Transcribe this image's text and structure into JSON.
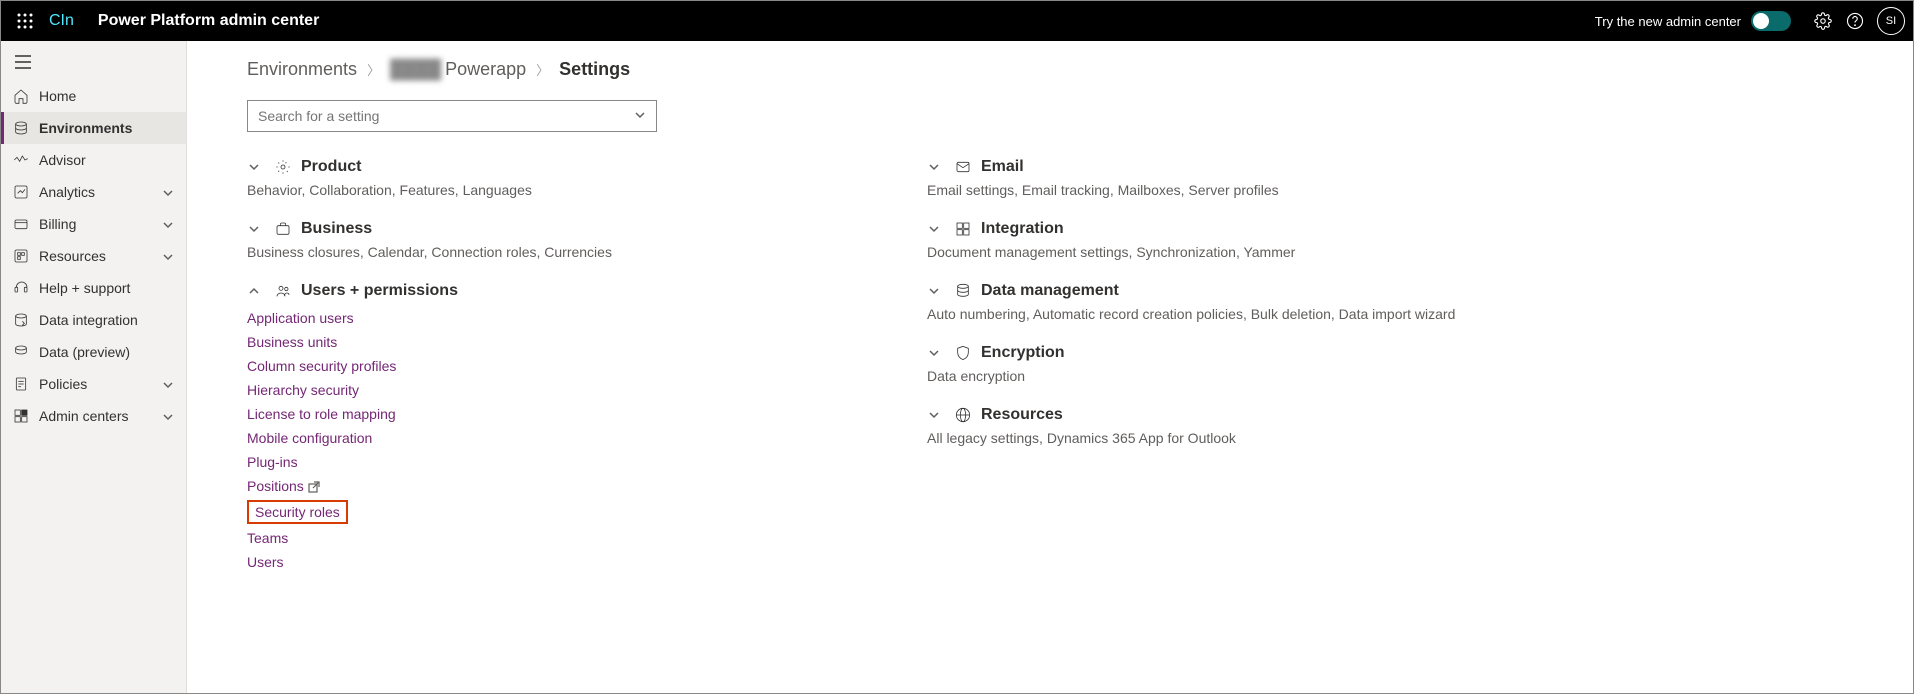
{
  "header": {
    "brand": "CIn",
    "title": "Power Platform admin center",
    "try_label": "Try the new admin center",
    "avatar": "SI"
  },
  "sidebar": {
    "items": [
      {
        "label": "Home",
        "icon": "home",
        "expandable": false,
        "active": false
      },
      {
        "label": "Environments",
        "icon": "environments",
        "expandable": false,
        "active": true
      },
      {
        "label": "Advisor",
        "icon": "advisor",
        "expandable": false,
        "active": false
      },
      {
        "label": "Analytics",
        "icon": "analytics",
        "expandable": true,
        "active": false
      },
      {
        "label": "Billing",
        "icon": "billing",
        "expandable": true,
        "active": false
      },
      {
        "label": "Resources",
        "icon": "resources",
        "expandable": true,
        "active": false
      },
      {
        "label": "Help + support",
        "icon": "help",
        "expandable": false,
        "active": false
      },
      {
        "label": "Data integration",
        "icon": "dataint",
        "expandable": false,
        "active": false
      },
      {
        "label": "Data (preview)",
        "icon": "data",
        "expandable": false,
        "active": false
      },
      {
        "label": "Policies",
        "icon": "policies",
        "expandable": true,
        "active": false
      },
      {
        "label": "Admin centers",
        "icon": "admin",
        "expandable": true,
        "active": false
      }
    ]
  },
  "breadcrumb": {
    "root": "Environments",
    "env": "Powerapp",
    "current": "Settings"
  },
  "search": {
    "placeholder": "Search for a setting"
  },
  "groups_left": [
    {
      "title": "Product",
      "icon": "gear",
      "expanded": false,
      "sub": "Behavior, Collaboration, Features, Languages",
      "links": []
    },
    {
      "title": "Business",
      "icon": "briefcase",
      "expanded": false,
      "sub": "Business closures, Calendar, Connection roles, Currencies",
      "links": []
    },
    {
      "title": "Users + permissions",
      "icon": "people",
      "expanded": true,
      "sub": "",
      "links": [
        {
          "label": "Application users",
          "highlight": false,
          "external": false
        },
        {
          "label": "Business units",
          "highlight": false,
          "external": false
        },
        {
          "label": "Column security profiles",
          "highlight": false,
          "external": false
        },
        {
          "label": "Hierarchy security",
          "highlight": false,
          "external": false
        },
        {
          "label": "License to role mapping",
          "highlight": false,
          "external": false
        },
        {
          "label": "Mobile configuration",
          "highlight": false,
          "external": false
        },
        {
          "label": "Plug-ins",
          "highlight": false,
          "external": false
        },
        {
          "label": "Positions",
          "highlight": false,
          "external": true
        },
        {
          "label": "Security roles",
          "highlight": true,
          "external": false
        },
        {
          "label": "Teams",
          "highlight": false,
          "external": false
        },
        {
          "label": "Users",
          "highlight": false,
          "external": false
        }
      ]
    }
  ],
  "groups_right": [
    {
      "title": "Email",
      "icon": "mail",
      "expanded": false,
      "sub": "Email settings, Email tracking, Mailboxes, Server profiles"
    },
    {
      "title": "Integration",
      "icon": "grid",
      "expanded": false,
      "sub": "Document management settings, Synchronization, Yammer"
    },
    {
      "title": "Data management",
      "icon": "database",
      "expanded": false,
      "sub": "Auto numbering, Automatic record creation policies, Bulk deletion, Data import wizard"
    },
    {
      "title": "Encryption",
      "icon": "shield",
      "expanded": false,
      "sub": "Data encryption"
    },
    {
      "title": "Resources",
      "icon": "globe",
      "expanded": false,
      "sub": "All legacy settings, Dynamics 365 App for Outlook"
    }
  ]
}
